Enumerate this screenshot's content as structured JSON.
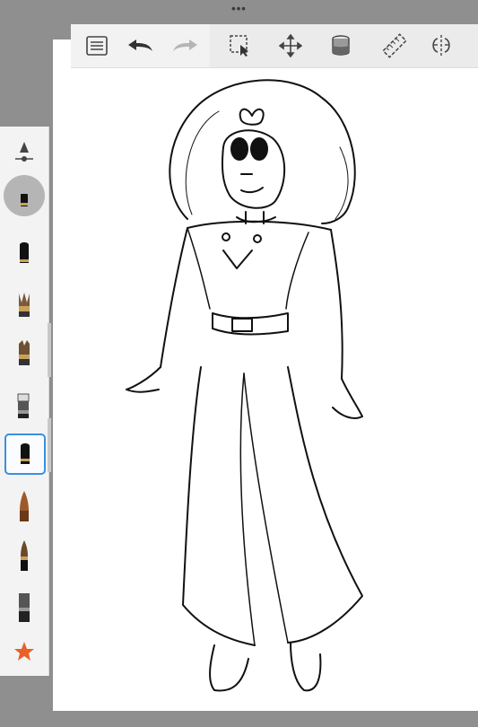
{
  "window": {
    "top_dots": "•••"
  },
  "toolbar": {
    "items": [
      {
        "name": "layers-list-icon",
        "label": ""
      },
      {
        "name": "undo-icon",
        "label": ""
      },
      {
        "name": "redo-icon",
        "label": ""
      },
      {
        "name": "selection-icon",
        "label": ""
      },
      {
        "name": "transform-move-icon",
        "label": ""
      },
      {
        "name": "fill-bucket-icon",
        "label": ""
      },
      {
        "name": "ruler-icon",
        "label": ""
      },
      {
        "name": "symmetry-icon",
        "label": ""
      }
    ]
  },
  "sidebar": {
    "brush_size_icon": "brush-size-slider-icon",
    "brushes": [
      {
        "name": "pencil-brush"
      },
      {
        "name": "paint-brush"
      },
      {
        "name": "airbrush"
      },
      {
        "name": "marker-brush"
      },
      {
        "name": "inker-brush",
        "selected": true
      },
      {
        "name": "pen-brush"
      },
      {
        "name": "fine-brush"
      },
      {
        "name": "flat-brush"
      }
    ],
    "favorite_icon": "star-icon"
  },
  "colors": {
    "accent": "#3a8fe0",
    "star": "#e8612a",
    "background": "#8f8f8f",
    "canvas": "#ffffff"
  }
}
